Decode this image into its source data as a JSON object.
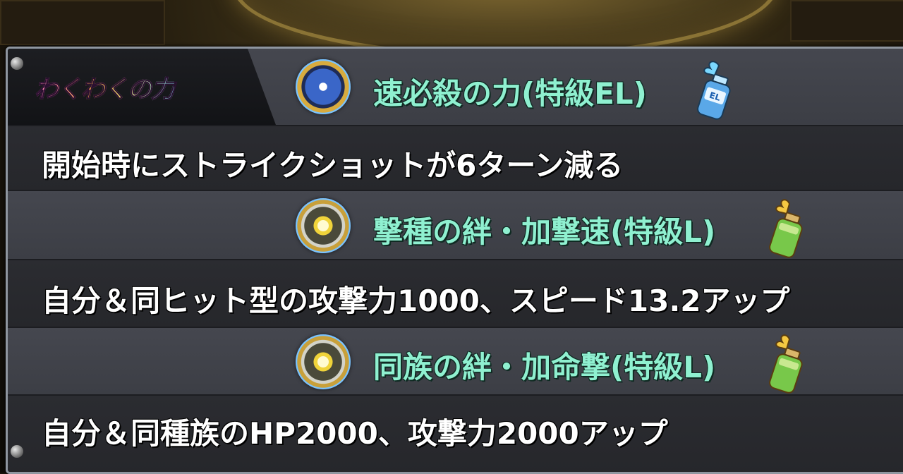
{
  "header_label": "わくわくの力",
  "skills": [
    {
      "name": "速必殺の力(特級EL)",
      "icon": "speed-special-icon",
      "item": "el-bottle-icon",
      "bottle_text": "EL",
      "description": "開始時にストライクショットが6ターン減る"
    },
    {
      "name": "撃種の絆・加撃速(特級L)",
      "icon": "strike-bond-icon",
      "item": "l-bottle-icon",
      "description": "自分＆同ヒット型の攻撃力1000、スピード13.2アップ"
    },
    {
      "name": "同族の絆・加命撃(特級L)",
      "icon": "tribe-bond-icon",
      "item": "l-bottle-icon",
      "description": "自分＆同種族のHP2000、攻撃力2000アップ"
    }
  ],
  "colors": {
    "skill_name": "#8ff0d0",
    "description": "#ffffff",
    "panel": "#3a3c43"
  }
}
